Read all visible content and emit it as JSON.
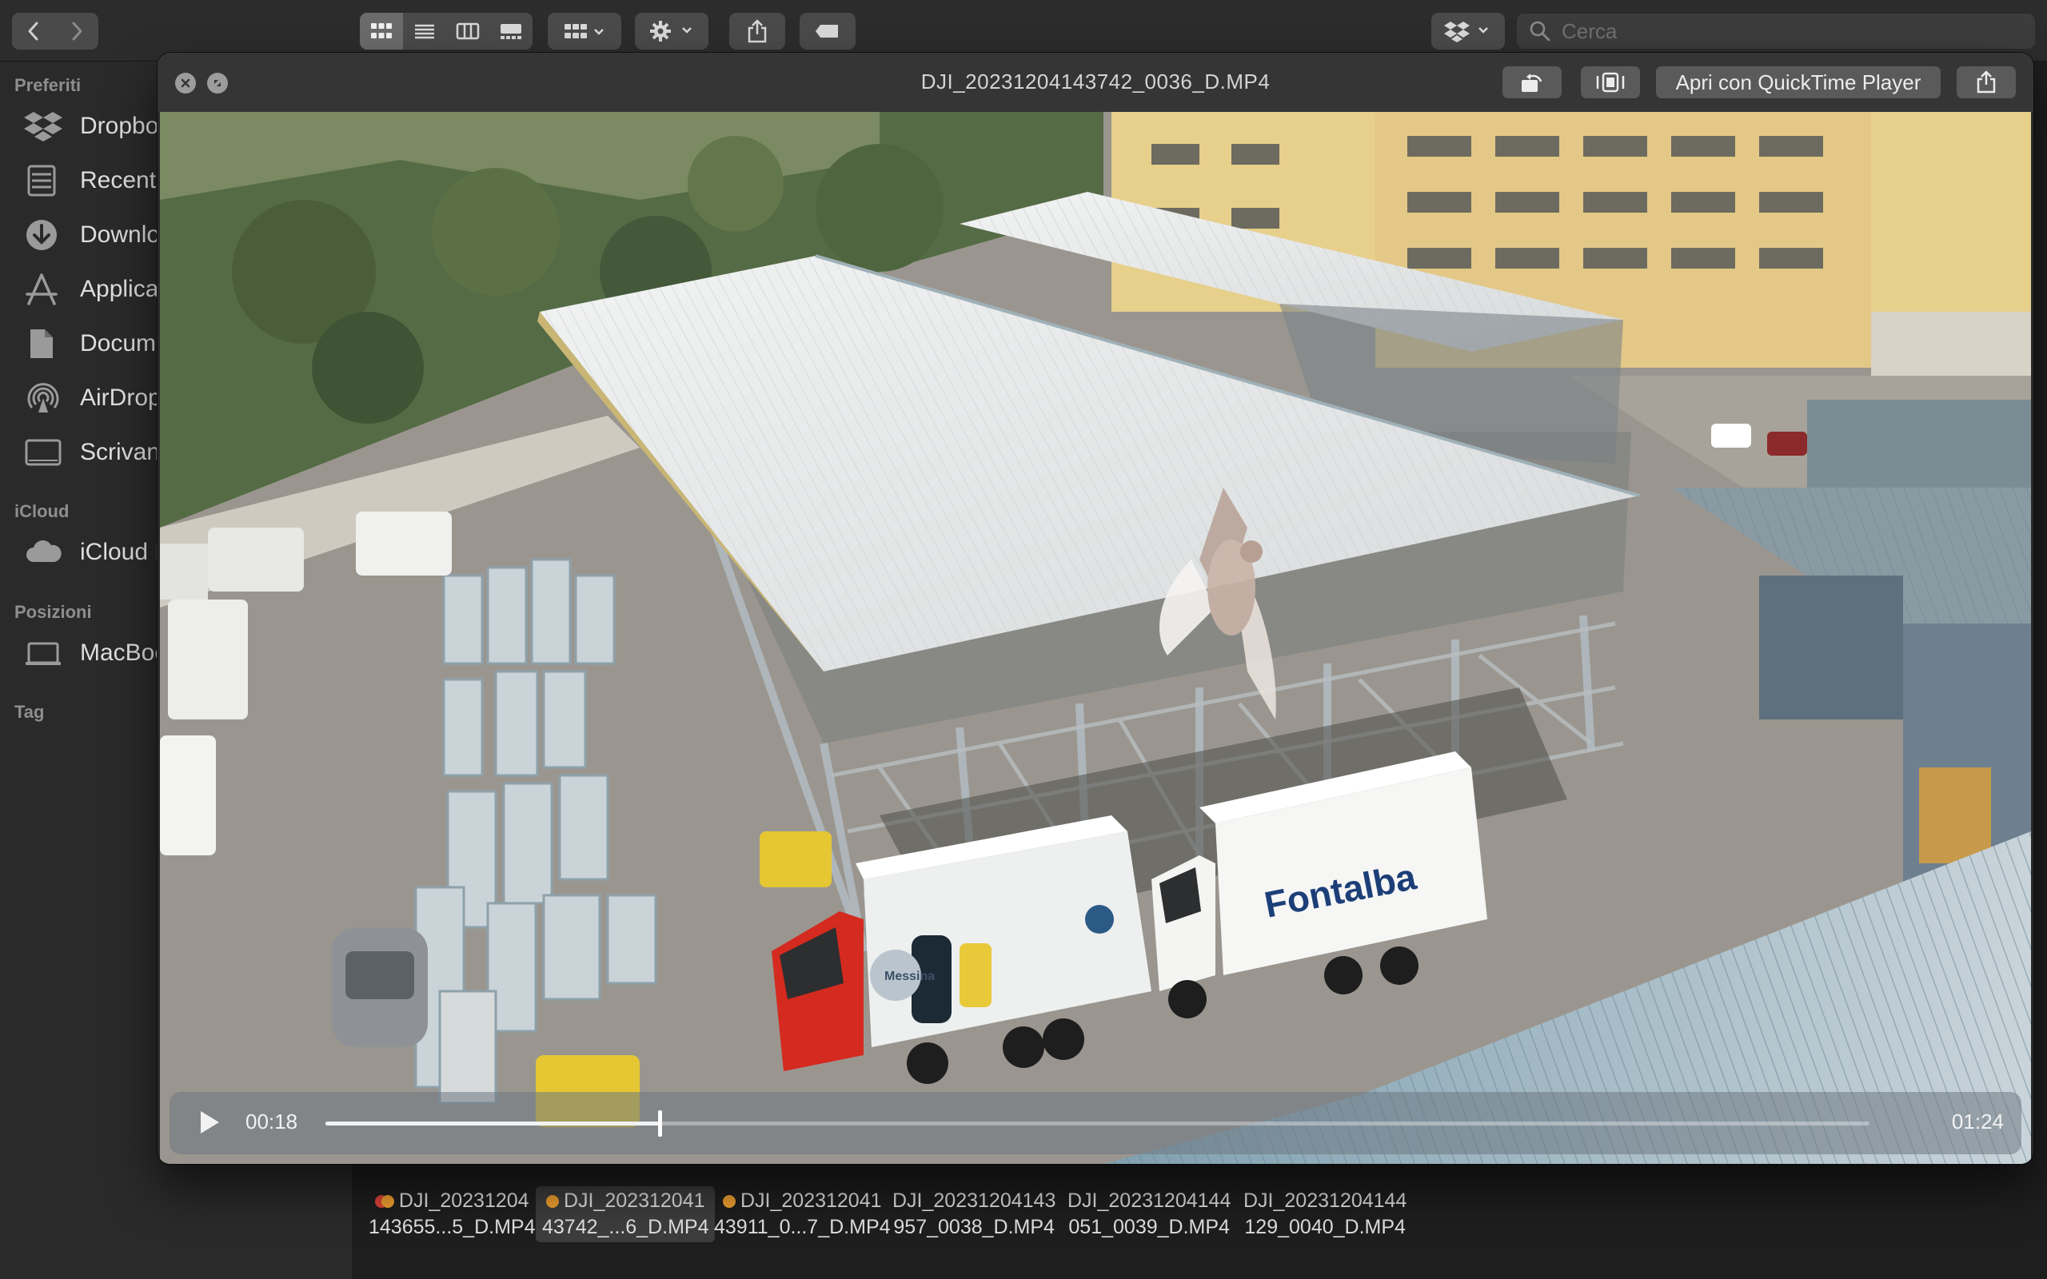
{
  "finder": {
    "search_placeholder": "Cerca",
    "sidebar": {
      "sections": [
        {
          "title": "Preferiti",
          "items": [
            {
              "label": "Dropbox",
              "icon": "dropbox-icon"
            },
            {
              "label": "Recenti",
              "icon": "recents-icon"
            },
            {
              "label": "Download",
              "icon": "download-icon"
            },
            {
              "label": "Applicazioni",
              "icon": "applications-icon"
            },
            {
              "label": "Documenti",
              "icon": "document-icon"
            },
            {
              "label": "AirDrop",
              "icon": "airdrop-icon"
            },
            {
              "label": "Scrivania",
              "icon": "desktop-icon"
            }
          ]
        },
        {
          "title": "iCloud",
          "items": [
            {
              "label": "iCloud Drive",
              "icon": "cloud-icon"
            }
          ]
        },
        {
          "title": "Posizioni",
          "items": [
            {
              "label": "MacBook",
              "icon": "laptop-icon"
            }
          ]
        },
        {
          "title": "Tag",
          "items": []
        }
      ]
    },
    "files": [
      {
        "line1": "DJI_20231204",
        "line2": "143655...5_D.MP4",
        "tag_colors": [
          "#e0443a",
          "#f0a030"
        ],
        "selected": false
      },
      {
        "line1": "DJI_202312041",
        "line2": "43742_...6_D.MP4",
        "tag_colors": [
          "#f0a030"
        ],
        "selected": true
      },
      {
        "line1": "DJI_202312041",
        "line2": "43911_0...7_D.MP4",
        "tag_colors": [
          "#f0a030"
        ],
        "selected": false
      },
      {
        "line1": "DJI_20231204143",
        "line2": "957_0038_D.MP4",
        "tag_colors": [],
        "selected": false
      },
      {
        "line1": "DJI_20231204144",
        "line2": "051_0039_D.MP4",
        "tag_colors": [],
        "selected": false
      },
      {
        "line1": "DJI_20231204144",
        "line2": "129_0040_D.MP4",
        "tag_colors": [],
        "selected": false
      }
    ]
  },
  "quicklook": {
    "title": "DJI_20231204143742_0036_D.MP4",
    "open_with_label": "Apri con QuickTime Player",
    "player": {
      "current_time": "00:18",
      "duration": "01:24",
      "progress": 0.2165
    },
    "video_text": {
      "truck_brand": "Fontalba",
      "truck_label": "Messina"
    }
  }
}
